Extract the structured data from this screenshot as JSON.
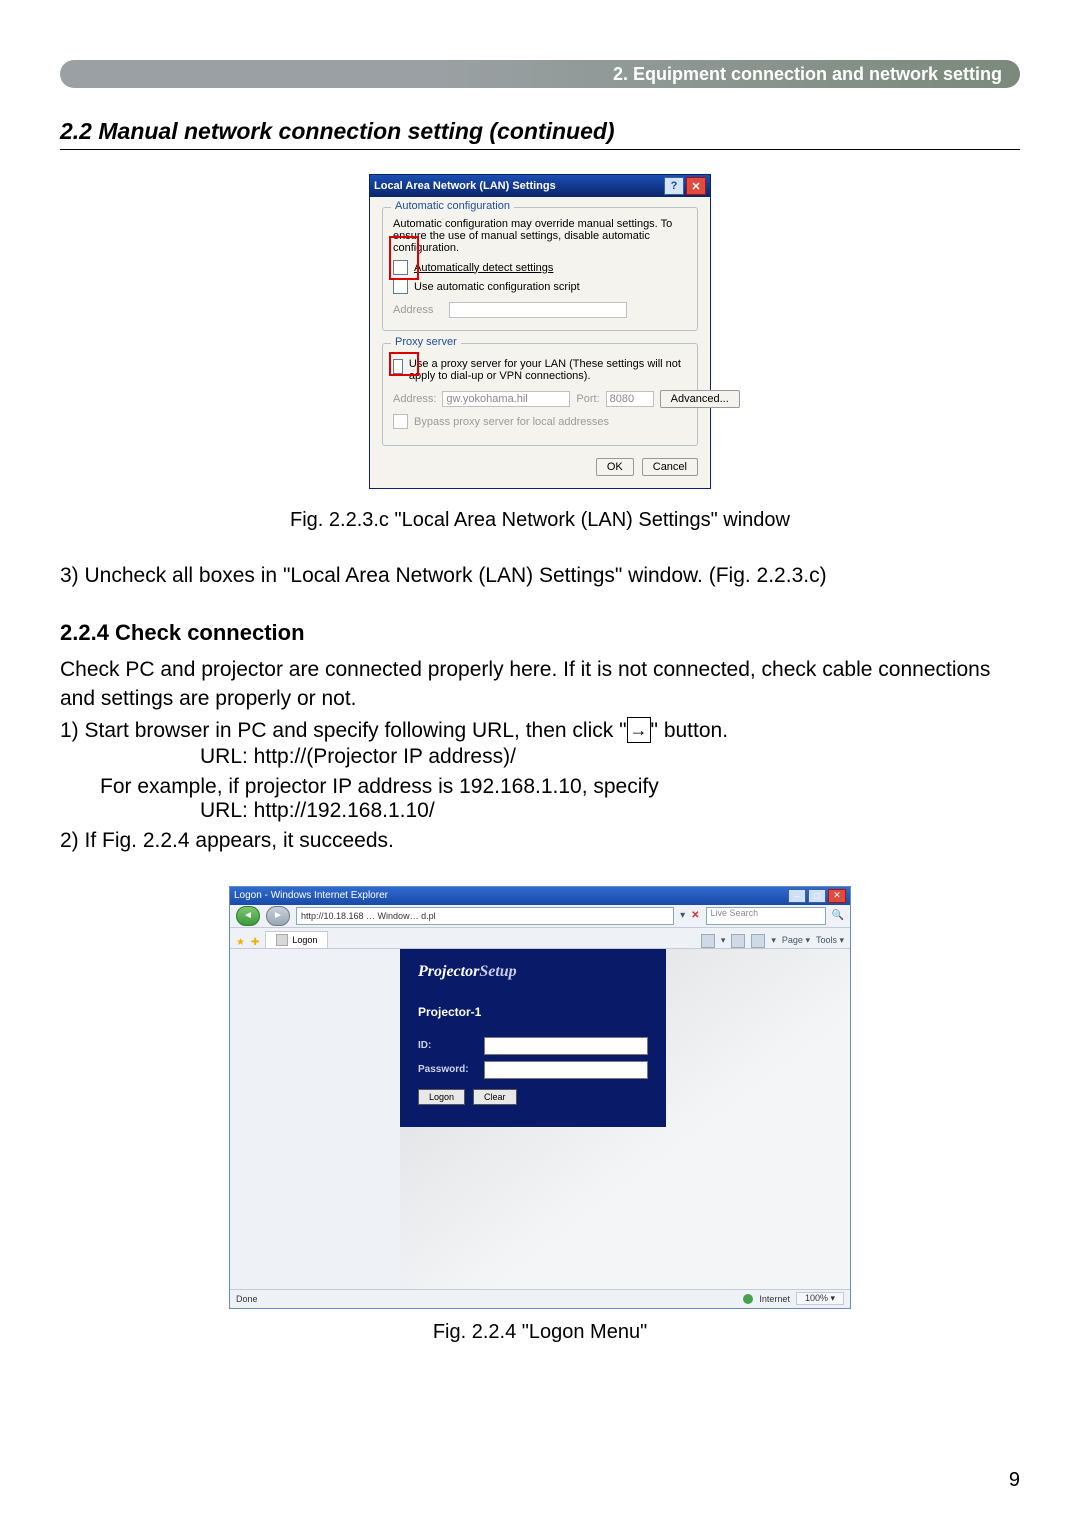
{
  "header": {
    "chapter": "2. Equipment connection and network setting"
  },
  "section_title": "2.2 Manual network connection setting (continued)",
  "lan_window": {
    "title": "Local Area Network (LAN) Settings",
    "help_icon": "?",
    "close_icon": "✕",
    "group_auto": {
      "legend": "Automatic configuration",
      "desc": "Automatic configuration may override manual settings. To ensure the use of manual settings, disable automatic configuration.",
      "cb1": "Automatically detect settings",
      "cb2": "Use automatic configuration script",
      "addr_label": "Address"
    },
    "group_proxy": {
      "legend": "Proxy server",
      "cb": "Use a proxy server for your LAN (These settings will not apply to dial-up or VPN connections).",
      "addr_label": "Address:",
      "addr_value": "gw.yokohama.hil",
      "port_label": "Port:",
      "port_value": "8080",
      "adv_btn": "Advanced...",
      "bypass": "Bypass proxy server for local addresses"
    },
    "ok": "OK",
    "cancel": "Cancel"
  },
  "fig_223c": "Fig. 2.2.3.c \"Local Area Network (LAN) Settings\" window",
  "step3": "3) Uncheck all boxes in \"Local Area Network (LAN) Settings\" window. (Fig. 2.2.3.c)",
  "subsec": "2.2.4 Check connection",
  "check_p": "Check PC and projector are connected properly here. If it is not connected, check cable connections and settings are properly or not.",
  "step1a": "1) Start browser in PC and specify following URL, then click \"",
  "step1b": "\" button.",
  "url1": "URL: http://(Projector IP address)/",
  "example_pre": "For example, if projector IP address is 192.168.1.10, specify",
  "url2": "URL: http://192.168.1.10/",
  "step2": "2) If Fig. 2.2.4 appears, it succeeds.",
  "ie": {
    "title": "Logon - Windows Internet Explorer",
    "min": "–",
    "max": "□",
    "close": "✕",
    "back": "◄",
    "fwd": "►",
    "address": "http://10.18.168 … Window… d.pl",
    "addr_dd": "▾",
    "refresh_x": "✕",
    "search_placeholder": "Live Search",
    "tab_label": "Logon",
    "tool_home": "Home",
    "tool_page": "Page ▾",
    "tool_tools": "Tools ▾",
    "ps_title1": "Projector",
    "ps_title2": "Setup",
    "projector_name": "Projector-1",
    "id_label": "ID:",
    "pw_label": "Password:",
    "logon_btn": "Logon",
    "clear_btn": "Clear",
    "status_done": "Done",
    "status_internet": "Internet",
    "status_zoom": "100%  ▾"
  },
  "fig_224": "Fig. 2.2.4 \"Logon Menu\"",
  "page_number": "9",
  "go_arrow": "→"
}
